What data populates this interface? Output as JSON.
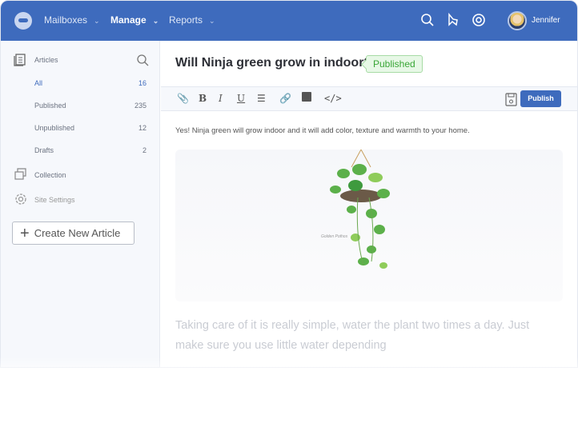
{
  "header": {
    "nav": [
      {
        "label": "Mailboxes"
      },
      {
        "label": "Manage"
      },
      {
        "label": "Reports"
      }
    ],
    "user": "Jennifer"
  },
  "sidebar": {
    "section": "Articles",
    "items": [
      {
        "label": "All",
        "count": "16"
      },
      {
        "label": "Published",
        "count": "235"
      },
      {
        "label": "Unpublished",
        "count": "12"
      },
      {
        "label": "Drafts",
        "count": "2"
      }
    ],
    "collection": "Collection",
    "settings": "Site Settings",
    "create": "Create New Article"
  },
  "article": {
    "title": "Will Ninja green grow in indoor?",
    "status": "Published",
    "publish": "Publish",
    "intro": "Yes! Ninja green will grow indoor and it  will add color, texture and warmth to your home.",
    "image_caption": "Golden Pothos",
    "body": "Taking care of it is really simple, water the plant two times a day. Just make sure you use little water depending"
  },
  "colors": {
    "brand": "#3e6bbd",
    "published": "#3aa637"
  }
}
